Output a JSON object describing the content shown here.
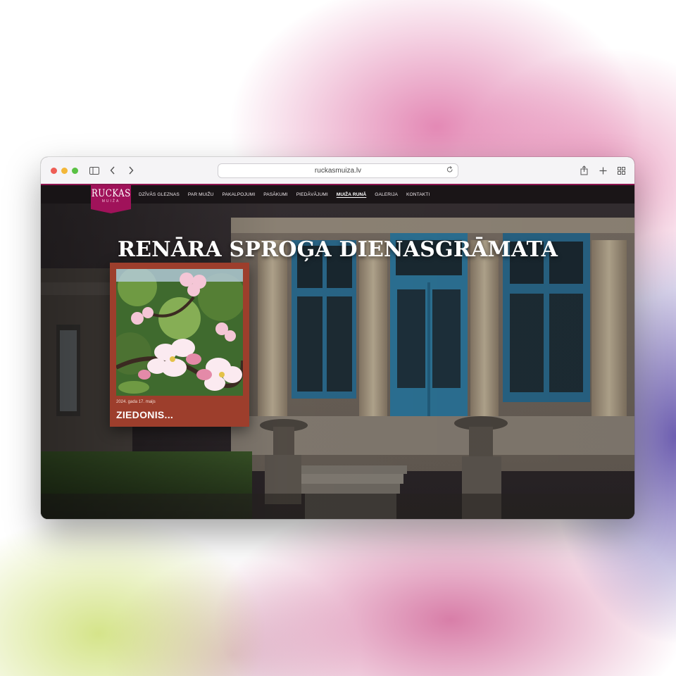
{
  "browser": {
    "url": "ruckasmuiza.lv",
    "icons": [
      "sidebar-icon",
      "back-icon",
      "forward-icon",
      "reload-icon",
      "share-icon",
      "new-tab-icon",
      "tab-overview-icon"
    ]
  },
  "site": {
    "logo": {
      "main": "RUCKAS",
      "sub": "MUIŽA"
    },
    "nav": [
      {
        "label": "DZĪVĀS GLEZNAS",
        "active": false
      },
      {
        "label": "PAR MUIŽU",
        "active": false
      },
      {
        "label": "PAKALPOJUMI",
        "active": false
      },
      {
        "label": "PASĀKUMI",
        "active": false
      },
      {
        "label": "PIEDĀVĀJUMI",
        "active": false
      },
      {
        "label": "MUIŽA RUNĀ",
        "active": true
      },
      {
        "label": "GALERIJA",
        "active": false
      },
      {
        "label": "KONTAKTI",
        "active": false
      }
    ],
    "hero_title": "RENĀRA SPROĢA DIENASGRĀMATA",
    "post": {
      "date": "2024. gada 17. maijs",
      "title": "ZIEDONIS...",
      "image": "apple-blossom-photo"
    }
  },
  "colors": {
    "brand": "#a0125a",
    "card": "#9d3e2c",
    "door_blue": "#2f7aa0"
  }
}
